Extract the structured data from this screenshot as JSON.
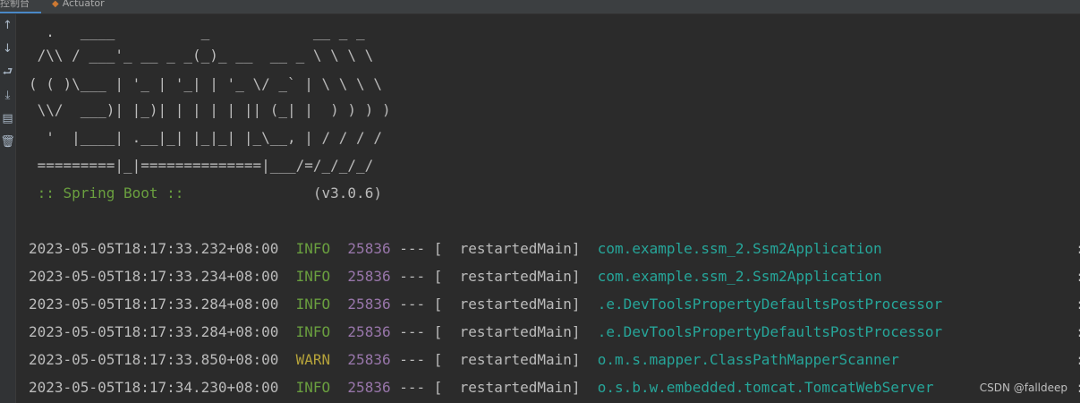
{
  "tabs": [
    {
      "label": "控制台",
      "active": true
    },
    {
      "label": "Actuator",
      "active": false
    }
  ],
  "gutter_icons": [
    "arrow-up-icon",
    "arrow-down-icon",
    "soft-wrap-icon",
    "scroll-to-end-icon",
    "print-icon",
    "trash-icon"
  ],
  "banner": [
    "  .   ____          _            __ _ _",
    " /\\\\ / ___'_ __ _ _(_)_ __  __ _ \\ \\ \\ \\",
    "( ( )\\___ | '_ | '_| | '_ \\/ _` | \\ \\ \\ \\",
    " \\\\/  ___)| |_)| | | | | || (_| |  ) ) ) )",
    "  '  |____| .__|_| |_|_| |_\\__, | / / / /",
    " =========|_|==============|___/=/_/_/_/"
  ],
  "spring_label": " :: Spring Boot :: ",
  "spring_version": "              (v3.0.6)",
  "log_lines": [
    {
      "timestamp": "2023-05-05T18:17:33.232+08:00",
      "level": "INFO",
      "pid": "25836",
      "sep": " --- [",
      "thread": "  restartedMain]",
      "logger": "com.example.ssm_2.Ssm2Application"
    },
    {
      "timestamp": "2023-05-05T18:17:33.234+08:00",
      "level": "INFO",
      "pid": "25836",
      "sep": " --- [",
      "thread": "  restartedMain]",
      "logger": "com.example.ssm_2.Ssm2Application"
    },
    {
      "timestamp": "2023-05-05T18:17:33.284+08:00",
      "level": "INFO",
      "pid": "25836",
      "sep": " --- [",
      "thread": "  restartedMain]",
      "logger": ".e.DevToolsPropertyDefaultsPostProcessor"
    },
    {
      "timestamp": "2023-05-05T18:17:33.284+08:00",
      "level": "INFO",
      "pid": "25836",
      "sep": " --- [",
      "thread": "  restartedMain]",
      "logger": ".e.DevToolsPropertyDefaultsPostProcessor"
    },
    {
      "timestamp": "2023-05-05T18:17:33.850+08:00",
      "level": "WARN",
      "pid": "25836",
      "sep": " --- [",
      "thread": "  restartedMain]",
      "logger": "o.m.s.mapper.ClassPathMapperScanner"
    },
    {
      "timestamp": "2023-05-05T18:17:34.230+08:00",
      "level": "INFO",
      "pid": "25836",
      "sep": " --- [",
      "thread": "  restartedMain]",
      "logger": "o.s.b.w.embedded.tomcat.TomcatWebServer"
    }
  ],
  "colon": ":",
  "watermark": "CSDN @falldeep"
}
